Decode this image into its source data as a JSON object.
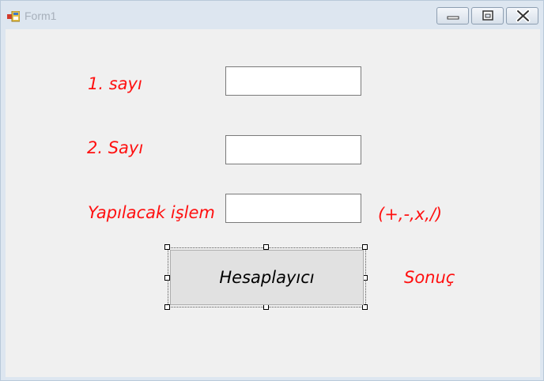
{
  "window": {
    "title": "Form1",
    "icon": "form-app-icon",
    "controls": {
      "minimize_icon": "minimize-icon",
      "maximize_icon": "maximize-icon",
      "close_icon": "close-icon"
    }
  },
  "form": {
    "label_1": "1. sayı",
    "label_2": "2. Sayı",
    "label_op": "Yapılacak işlem",
    "op_hint": "(+,-,x,/)",
    "input_1_value": "",
    "input_2_value": "",
    "input_op_value": "",
    "calc_button": "Hesaplayıcı",
    "result_label": "Sonuç"
  },
  "colors": {
    "label_text": "#ff1010",
    "client_bg": "#f0f0f0",
    "button_bg": "#e1e1e1"
  }
}
